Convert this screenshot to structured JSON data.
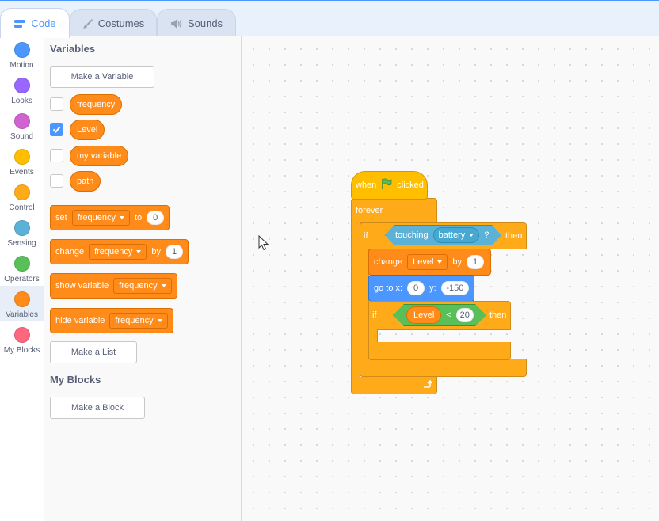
{
  "tabs": [
    {
      "label": "Code",
      "icon": "code-icon",
      "active": true
    },
    {
      "label": "Costumes",
      "icon": "brush-icon",
      "active": false
    },
    {
      "label": "Sounds",
      "icon": "speaker-icon",
      "active": false
    }
  ],
  "categories": [
    {
      "label": "Motion",
      "color": "#4c97ff"
    },
    {
      "label": "Looks",
      "color": "#9966ff"
    },
    {
      "label": "Sound",
      "color": "#cf63cf"
    },
    {
      "label": "Events",
      "color": "#ffbf00"
    },
    {
      "label": "Control",
      "color": "#ffab19"
    },
    {
      "label": "Sensing",
      "color": "#5cb1d6"
    },
    {
      "label": "Operators",
      "color": "#59c059"
    },
    {
      "label": "Variables",
      "color": "#ff8c1a",
      "selected": true
    },
    {
      "label": "My Blocks",
      "color": "#ff6680"
    }
  ],
  "palette": {
    "variables_heading": "Variables",
    "make_variable": "Make a Variable",
    "variables": [
      {
        "name": "frequency",
        "checked": false
      },
      {
        "name": "Level",
        "checked": true
      },
      {
        "name": "my variable",
        "checked": false
      },
      {
        "name": "path",
        "checked": false
      }
    ],
    "set_block": {
      "label": "set",
      "var": "frequency",
      "mid": "to",
      "value": "0"
    },
    "change_block": {
      "label": "change",
      "var": "frequency",
      "mid": "by",
      "value": "1"
    },
    "show_block": {
      "label": "show variable",
      "var": "frequency"
    },
    "hide_block": {
      "label": "hide variable",
      "var": "frequency"
    },
    "make_list": "Make a List",
    "myblocks_heading": "My Blocks",
    "make_block": "Make a Block"
  },
  "script": {
    "hat": {
      "when": "when",
      "clicked": "clicked"
    },
    "forever": "forever",
    "if1": {
      "if": "if",
      "touching": "touching",
      "target": "battery",
      "q": "?",
      "then": "then"
    },
    "change": {
      "label": "change",
      "var": "Level",
      "by": "by",
      "value": "1"
    },
    "goto": {
      "label": "go to x:",
      "x": "0",
      "ylabel": "y:",
      "y": "-150"
    },
    "if2": {
      "if": "if",
      "var": "Level",
      "op": "<",
      "value": "20",
      "then": "then"
    }
  },
  "colors": {
    "accent": "#4c97ff",
    "variables": "#ff8c1a",
    "control": "#ffab19",
    "events": "#ffbf00",
    "motion": "#4c97ff",
    "sensing": "#5cb1d6",
    "operators": "#59c059"
  }
}
